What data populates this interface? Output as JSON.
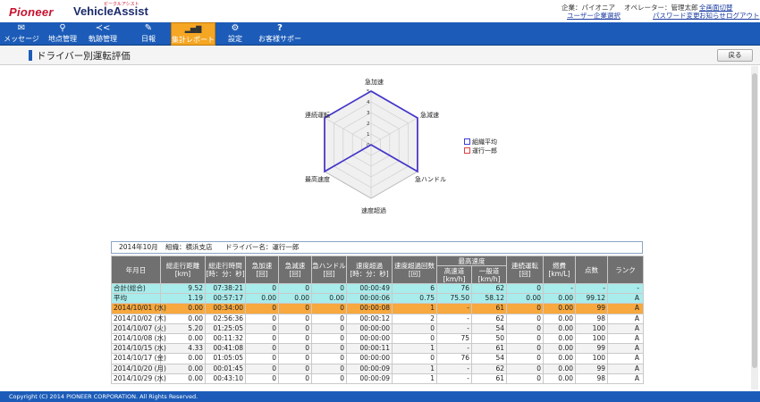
{
  "brand": {
    "pioneer": "Pioneer",
    "product": "VehicleAssist",
    "product_sub": "ビークルアシスト"
  },
  "header": {
    "company": "企業：パイオニア",
    "company_link": "ユーザー企業選択",
    "operator": "オペレーター：管理太郎",
    "password_link": "パスワード変更",
    "fullscreen_link": "全画面切替",
    "notice_link": "お知らせ",
    "logout_link": "ログアウト"
  },
  "nav": [
    {
      "label": "メッセージ",
      "icon": "envelope-icon",
      "glyph": "✉"
    },
    {
      "label": "地点管理",
      "icon": "map-pin-icon",
      "glyph": "⚲"
    },
    {
      "label": "軌跡管理",
      "icon": "track-icon",
      "glyph": "≺<"
    },
    {
      "label": "日報",
      "icon": "pencil-icon",
      "glyph": "✎"
    },
    {
      "label": "集計レポート",
      "icon": "bar-chart-icon",
      "glyph": "▂▅▇"
    },
    {
      "label": "設定",
      "icon": "gear-icon",
      "glyph": "⚙"
    },
    {
      "label": "お客様サポート",
      "icon": "question-icon",
      "glyph": "?"
    }
  ],
  "page": {
    "title": "ドライバー別運転評価",
    "back": "戻る"
  },
  "radar": {
    "axes": [
      "急加速",
      "急減速",
      "急ハンドル",
      "速度超過",
      "最高速度",
      "連続運転"
    ],
    "ticks": [
      "0",
      "1",
      "2",
      "3",
      "4",
      "5"
    ],
    "max": 5,
    "series": [
      {
        "name": "組織平均",
        "color": "#3b3bd6",
        "values": [
          5,
          5,
          5,
          0,
          5,
          5
        ]
      },
      {
        "name": "運行一郎",
        "color": "#e04040",
        "values": [
          5,
          5,
          5,
          0,
          5,
          5
        ]
      }
    ]
  },
  "info": {
    "month": "2014年10月",
    "org": "組織：横浜支店",
    "driver": "ドライバー名：運行一郎"
  },
  "table": {
    "headers": {
      "date": "年月日",
      "distance": "総走行距離",
      "distance_unit": "[km]",
      "time": "総走行時間",
      "time_unit": "[時：分：秒]",
      "accel": "急加速",
      "accel_unit": "[回]",
      "decel": "急減速",
      "decel_unit": "[回]",
      "handle": "急ハンドル",
      "handle_unit": "[回]",
      "overspeed": "速度超過",
      "overspeed_unit": "[時：分：秒]",
      "overspeed_count": "速度超過回数",
      "overspeed_count_unit": "[回]",
      "maxspeed": "最高速度",
      "highway": "高速道",
      "highway_unit": "[km/h]",
      "general": "一般道",
      "general_unit": "[km/h]",
      "continuous": "連続運転",
      "continuous_unit": "[回]",
      "fuel": "燃費",
      "fuel_unit": "[km/L]",
      "score": "点数",
      "rank": "ランク"
    },
    "rows": [
      {
        "kind": "total",
        "cells": [
          "合計(総合)",
          "9.52",
          "07:38:21",
          "0",
          "0",
          "0",
          "00:00:49",
          "6",
          "76",
          "62",
          "0",
          "-",
          "-",
          "-"
        ]
      },
      {
        "kind": "avg",
        "cells": [
          "平均",
          "1.19",
          "00:57:17",
          "0.00",
          "0.00",
          "0.00",
          "00:00:06",
          "0.75",
          "75.50",
          "58.12",
          "0.00",
          "0.00",
          "99.12",
          "A"
        ]
      },
      {
        "kind": "hl",
        "cells": [
          "2014/10/01 (水)",
          "0.00",
          "00:34:00",
          "0",
          "0",
          "0",
          "00:00:08",
          "1",
          "-",
          "61",
          "0",
          "0.00",
          "99",
          "A"
        ]
      },
      {
        "kind": "odd",
        "cells": [
          "2014/10/02 (木)",
          "0.00",
          "02:56:36",
          "0",
          "0",
          "0",
          "00:00:12",
          "2",
          "-",
          "62",
          "0",
          "0.00",
          "98",
          "A"
        ]
      },
      {
        "kind": "even",
        "cells": [
          "2014/10/07 (火)",
          "5.20",
          "01:25:05",
          "0",
          "0",
          "0",
          "00:00:00",
          "0",
          "-",
          "54",
          "0",
          "0.00",
          "100",
          "A"
        ]
      },
      {
        "kind": "odd",
        "cells": [
          "2014/10/08 (水)",
          "0.00",
          "00:11:32",
          "0",
          "0",
          "0",
          "00:00:00",
          "0",
          "75",
          "50",
          "0",
          "0.00",
          "100",
          "A"
        ]
      },
      {
        "kind": "even",
        "cells": [
          "2014/10/15 (水)",
          "4.33",
          "00:41:08",
          "0",
          "0",
          "0",
          "00:00:11",
          "1",
          "-",
          "61",
          "0",
          "0.00",
          "99",
          "A"
        ]
      },
      {
        "kind": "odd",
        "cells": [
          "2014/10/17 (金)",
          "0.00",
          "01:05:05",
          "0",
          "0",
          "0",
          "00:00:00",
          "0",
          "76",
          "54",
          "0",
          "0.00",
          "100",
          "A"
        ]
      },
      {
        "kind": "even",
        "cells": [
          "2014/10/20 (月)",
          "0.00",
          "00:01:45",
          "0",
          "0",
          "0",
          "00:00:09",
          "1",
          "-",
          "62",
          "0",
          "0.00",
          "99",
          "A"
        ]
      },
      {
        "kind": "odd",
        "cells": [
          "2014/10/29 (水)",
          "0.00",
          "00:43:10",
          "0",
          "0",
          "0",
          "00:00:09",
          "1",
          "-",
          "61",
          "0",
          "0.00",
          "98",
          "A"
        ]
      }
    ]
  },
  "footer": {
    "copyright": "Copyright (C) 2014 PIONEER CORPORATION. All Rights Reserved."
  }
}
